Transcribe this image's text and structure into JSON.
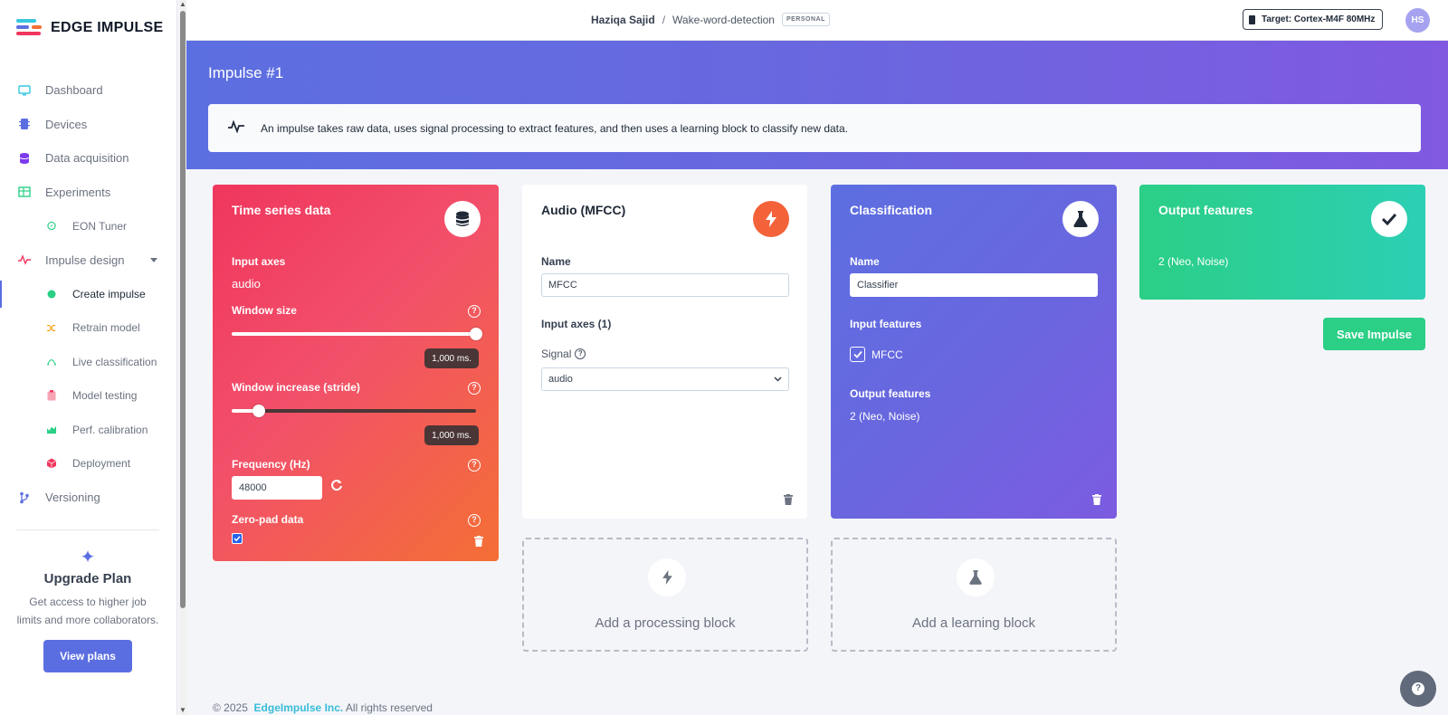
{
  "app": {
    "brand": "EDGE IMPULSE"
  },
  "sidebar": {
    "items": [
      {
        "label": "Dashboard",
        "icon": "monitor-icon"
      },
      {
        "label": "Devices",
        "icon": "chip-icon"
      },
      {
        "label": "Data acquisition",
        "icon": "database-icon"
      },
      {
        "label": "Experiments",
        "icon": "table-icon"
      },
      {
        "label": "EON Tuner",
        "icon": "compass-icon"
      },
      {
        "label": "Impulse design",
        "icon": "pulse-icon"
      },
      {
        "label": "Create impulse",
        "icon": "dot-icon"
      },
      {
        "label": "Retrain model",
        "icon": "shuffle-icon"
      },
      {
        "label": "Live classification",
        "icon": "curve-icon"
      },
      {
        "label": "Model testing",
        "icon": "clipboard-icon"
      },
      {
        "label": "Perf. calibration",
        "icon": "area-chart-icon"
      },
      {
        "label": "Deployment",
        "icon": "cube-icon"
      },
      {
        "label": "Versioning",
        "icon": "branch-icon"
      }
    ],
    "upgrade": {
      "title": "Upgrade Plan",
      "text": "Get access to higher job limits and more collaborators.",
      "button": "View plans"
    }
  },
  "header": {
    "user": "Haziqa Sajid",
    "separator": "/",
    "project": "Wake-word-detection",
    "badge": "PERSONAL",
    "target": "Target: Cortex-M4F 80MHz",
    "avatar": "HS"
  },
  "hero": {
    "title": "Impulse #1",
    "info": "An impulse takes raw data, uses signal processing to extract features, and then uses a learning block to classify new data."
  },
  "time_series": {
    "title": "Time series data",
    "input_axes_label": "Input axes",
    "input_axes_value": "audio",
    "window_size_label": "Window size",
    "window_size_value": "1,000 ms.",
    "window_size_fraction": 1.0,
    "stride_label": "Window increase (stride)",
    "stride_value": "1,000 ms.",
    "stride_fraction": 0.11,
    "frequency_label": "Frequency (Hz)",
    "frequency_value": "48000",
    "zeropad_label": "Zero-pad data",
    "zeropad_checked": true
  },
  "mfcc": {
    "title": "Audio (MFCC)",
    "name_label": "Name",
    "name_value": "MFCC",
    "input_axes_label": "Input axes (1)",
    "signal_label": "Signal",
    "signal_value": "audio"
  },
  "classification": {
    "title": "Classification",
    "name_label": "Name",
    "name_value": "Classifier",
    "input_features_label": "Input features",
    "input_feature": "MFCC",
    "output_features_label": "Output features",
    "output_features_value": "2 (Neo, Noise)"
  },
  "output": {
    "title": "Output features",
    "value": "2 (Neo, Noise)"
  },
  "save_button": "Save Impulse",
  "add_processing": "Add a processing block",
  "add_learning": "Add a learning block",
  "footer": {
    "year": "© 2025",
    "company": "EdgeImpulse Inc.",
    "rights": "All rights reserved"
  },
  "colors": {
    "accent": "#5b6ee1",
    "time_series": "#f0365d",
    "mfcc_icon": "#f4623a",
    "output": "#2bcf86"
  }
}
